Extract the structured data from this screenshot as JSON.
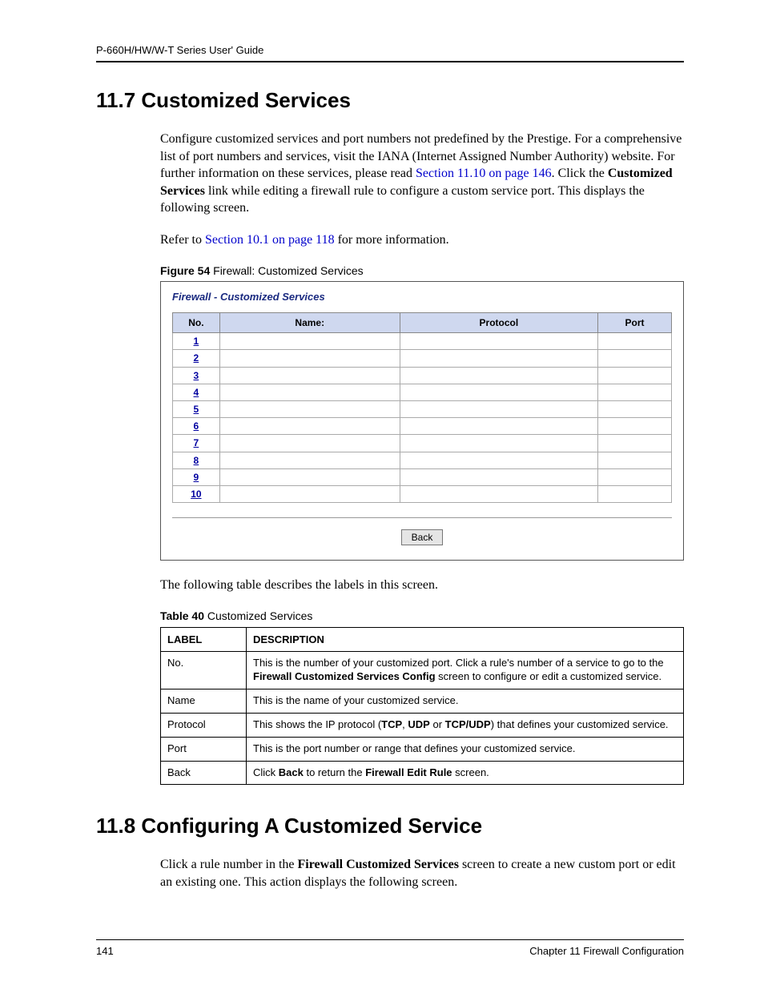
{
  "header": {
    "title": "P-660H/HW/W-T Series User' Guide"
  },
  "section1": {
    "number_title": "11.7  Customized Services",
    "para1_pre": "Configure customized services and port numbers not predefined by the Prestige. For a comprehensive list of port numbers and services, visit the IANA (Internet Assigned Number Authority) website. For further information on these services, please read ",
    "para1_link": "Section 11.10 on page 146",
    "para1_post_dot": ". ",
    "para1_post_a": "Click the ",
    "para1_bold": "Customized Services",
    "para1_post_b": " link while editing a firewall rule to configure a custom service port. This displays the following screen.",
    "para2_pre": "Refer to ",
    "para2_link": "Section 10.1 on page 118",
    "para2_post": " for more information."
  },
  "figure": {
    "caption_bold": "Figure 54",
    "caption_rest": "   Firewall: Customized Services",
    "title": "Firewall - Customized Services",
    "headers": {
      "no": "No.",
      "name": "Name:",
      "protocol": "Protocol",
      "port": "Port"
    },
    "rows": [
      "1",
      "2",
      "3",
      "4",
      "5",
      "6",
      "7",
      "8",
      "9",
      "10"
    ],
    "back": "Back"
  },
  "after_figure": "The following table describes the labels in this screen.",
  "table40": {
    "caption_bold": "Table 40",
    "caption_rest": "   Customized Services",
    "head_label": "LABEL",
    "head_desc": "DESCRIPTION",
    "rows": [
      {
        "label": "No.",
        "desc_pre": "This is the number of your customized port. Click a rule's number of a service to go to the ",
        "desc_bold": "Firewall Customized Services Config",
        "desc_post": " screen to configure or edit a customized service."
      },
      {
        "label": "Name",
        "desc_plain": "This is the name of your customized service."
      },
      {
        "label": "Protocol",
        "desc_pre": "This shows the IP protocol (",
        "desc_bold": "TCP",
        "desc_mid1": ", ",
        "desc_bold2": "UDP",
        "desc_mid2": " or ",
        "desc_bold3": "TCP/UDP",
        "desc_post": ") that defines your customized service."
      },
      {
        "label": "Port",
        "desc_plain": "This is the port number or range that defines your customized service."
      },
      {
        "label": "Back",
        "desc_pre": "Click ",
        "desc_bold": "Back",
        "desc_mid1": " to return the ",
        "desc_bold2": "Firewall Edit Rule",
        "desc_post": " screen."
      }
    ]
  },
  "section2": {
    "number_title": "11.8  Configuring A Customized Service",
    "para_pre": "Click a rule number in the ",
    "para_bold": "Firewall Customized Services",
    "para_post": " screen to create a new custom port or edit an existing one. This action displays the following screen."
  },
  "footer": {
    "page": "141",
    "chapter": "Chapter 11 Firewall Configuration"
  }
}
